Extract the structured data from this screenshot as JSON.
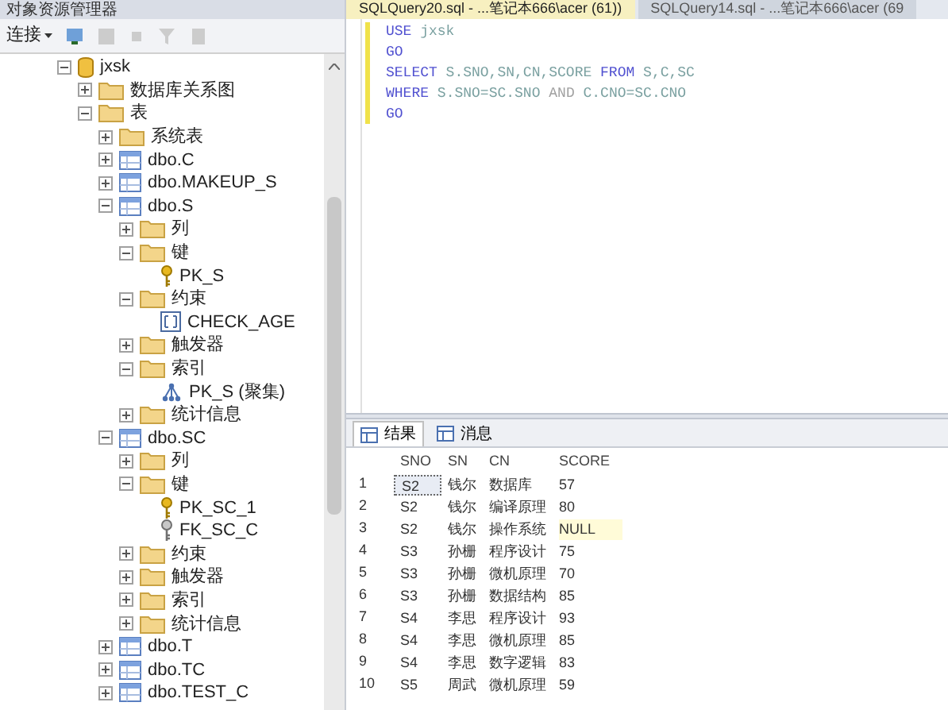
{
  "explorer": {
    "title": "对象资源管理器",
    "toolbar": {
      "connect": "连接"
    },
    "tree": [
      {
        "label": "jxsk",
        "kind": "database",
        "expanded": true,
        "children": [
          {
            "label": "数据库关系图",
            "kind": "folder",
            "expanded": false
          },
          {
            "label": "表",
            "kind": "folder",
            "expanded": true,
            "children": [
              {
                "label": "系统表",
                "kind": "folder",
                "expanded": false
              },
              {
                "label": "dbo.C",
                "kind": "table",
                "expanded": false
              },
              {
                "label": "dbo.MAKEUP_S",
                "kind": "table",
                "expanded": false
              },
              {
                "label": "dbo.S",
                "kind": "table",
                "expanded": true,
                "children": [
                  {
                    "label": "列",
                    "kind": "folder",
                    "expanded": false
                  },
                  {
                    "label": "键",
                    "kind": "folder",
                    "expanded": true,
                    "children": [
                      {
                        "label": "PK_S",
                        "kind": "primary-key"
                      }
                    ]
                  },
                  {
                    "label": "约束",
                    "kind": "folder",
                    "expanded": true,
                    "children": [
                      {
                        "label": "CHECK_AGE",
                        "kind": "constraint"
                      }
                    ]
                  },
                  {
                    "label": "触发器",
                    "kind": "folder",
                    "expanded": false
                  },
                  {
                    "label": "索引",
                    "kind": "folder",
                    "expanded": true,
                    "children": [
                      {
                        "label": "PK_S (聚集)",
                        "kind": "index"
                      }
                    ]
                  },
                  {
                    "label": "统计信息",
                    "kind": "folder",
                    "expanded": false
                  }
                ]
              },
              {
                "label": "dbo.SC",
                "kind": "table",
                "expanded": true,
                "children": [
                  {
                    "label": "列",
                    "kind": "folder",
                    "expanded": false
                  },
                  {
                    "label": "键",
                    "kind": "folder",
                    "expanded": true,
                    "children": [
                      {
                        "label": "PK_SC_1",
                        "kind": "primary-key"
                      },
                      {
                        "label": "FK_SC_C",
                        "kind": "foreign-key"
                      }
                    ]
                  },
                  {
                    "label": "约束",
                    "kind": "folder",
                    "expanded": false
                  },
                  {
                    "label": "触发器",
                    "kind": "folder",
                    "expanded": false
                  },
                  {
                    "label": "索引",
                    "kind": "folder",
                    "expanded": false
                  },
                  {
                    "label": "统计信息",
                    "kind": "folder",
                    "expanded": false
                  }
                ]
              },
              {
                "label": "dbo.T",
                "kind": "table",
                "expanded": false
              },
              {
                "label": "dbo.TC",
                "kind": "table",
                "expanded": false
              },
              {
                "label": "dbo.TEST_C",
                "kind": "table",
                "expanded": false
              }
            ]
          }
        ]
      }
    ]
  },
  "editor_tabs": [
    {
      "label": "SQLQuery20.sql - ...笔记本666\\acer (61))",
      "selected": true
    },
    {
      "label": "SQLQuery14.sql - ...笔记本666\\acer (69",
      "selected": false
    }
  ],
  "code": [
    [
      {
        "t": "USE",
        "kind": "keyword"
      },
      {
        "t": " jxsk",
        "kind": "identifier"
      }
    ],
    [
      {
        "t": "GO",
        "kind": "keyword"
      }
    ],
    [
      {
        "t": "SELECT",
        "kind": "keyword"
      },
      {
        "t": " S.SNO,SN,CN,SCORE ",
        "kind": "identifier"
      },
      {
        "t": "FROM",
        "kind": "keyword"
      },
      {
        "t": " S,C,SC",
        "kind": "identifier"
      }
    ],
    [
      {
        "t": "WHERE",
        "kind": "keyword"
      },
      {
        "t": " S.SNO=SC.SNO ",
        "kind": "identifier"
      },
      {
        "t": "AND",
        "kind": "operator"
      },
      {
        "t": " C.CNO=SC.CNO",
        "kind": "identifier"
      }
    ],
    [
      {
        "t": "GO",
        "kind": "keyword"
      }
    ]
  ],
  "result_tabs": [
    {
      "label": "结果",
      "selected": true
    },
    {
      "label": "消息",
      "selected": false
    }
  ],
  "results": {
    "columns": [
      "SNO",
      "SN",
      "CN",
      "SCORE"
    ],
    "rows": [
      {
        "n": "1",
        "cells": [
          "S2",
          "钱尔",
          "数据库",
          "57"
        ],
        "selected": true,
        "null_score": false
      },
      {
        "n": "2",
        "cells": [
          "S2",
          "钱尔",
          "编译原理",
          "80"
        ],
        "selected": false,
        "null_score": false
      },
      {
        "n": "3",
        "cells": [
          "S2",
          "钱尔",
          "操作系统",
          "NULL"
        ],
        "selected": false,
        "null_score": true
      },
      {
        "n": "4",
        "cells": [
          "S3",
          "孙栅",
          "程序设计",
          "75"
        ],
        "selected": false,
        "null_score": false
      },
      {
        "n": "5",
        "cells": [
          "S3",
          "孙栅",
          "微机原理",
          "70"
        ],
        "selected": false,
        "null_score": false
      },
      {
        "n": "6",
        "cells": [
          "S3",
          "孙栅",
          "数据结构",
          "85"
        ],
        "selected": false,
        "null_score": false
      },
      {
        "n": "7",
        "cells": [
          "S4",
          "李思",
          "程序设计",
          "93"
        ],
        "selected": false,
        "null_score": false
      },
      {
        "n": "8",
        "cells": [
          "S4",
          "李思",
          "微机原理",
          "85"
        ],
        "selected": false,
        "null_score": false
      },
      {
        "n": "9",
        "cells": [
          "S4",
          "李思",
          "数字逻辑",
          "83"
        ],
        "selected": false,
        "null_score": false
      },
      {
        "n": "10",
        "cells": [
          "S5",
          "周武",
          "微机原理",
          "59"
        ],
        "selected": false,
        "null_score": false
      }
    ]
  }
}
